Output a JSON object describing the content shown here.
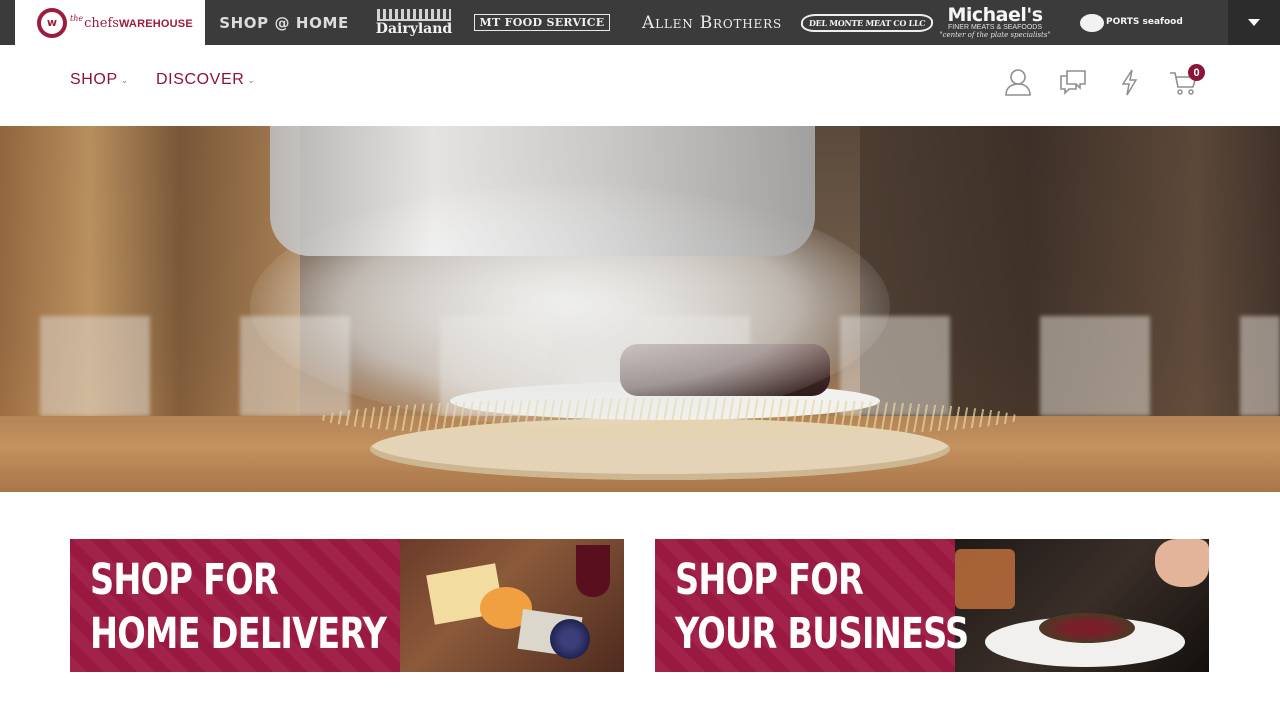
{
  "brand_bar": {
    "active_brand": {
      "name": "chefs",
      "prefix": "the",
      "suffix": "WAREHOUSE",
      "logo_letter": "w"
    },
    "brands": [
      {
        "id": "shop-at-home",
        "label": "SHOP @ HOME"
      },
      {
        "id": "dairyland",
        "label": "Dairyland"
      },
      {
        "id": "mt-food-service",
        "label": "MT FOOD SERVICE"
      },
      {
        "id": "allen-brothers",
        "label": "Allen Brothers"
      },
      {
        "id": "del-monte-meat",
        "label": "DEL MONTE MEAT CO LLC"
      },
      {
        "id": "michaels",
        "label": "Michael's",
        "sub": "FINER MEATS & SEAFOODS",
        "tagline": "\"center of the plate specialists\""
      },
      {
        "id": "ports-seafood",
        "label": "PORTS seafood"
      }
    ],
    "toggle_icon": "triangle-down-icon"
  },
  "nav": {
    "menu": [
      {
        "label": "SHOP",
        "icon": "chevron-down-icon"
      },
      {
        "label": "DISCOVER",
        "icon": "chevron-down-icon"
      }
    ],
    "icons": [
      "user-icon",
      "chat-icon",
      "lightning-icon",
      "cart-icon"
    ],
    "cart_count": "0"
  },
  "hero": {
    "image": "smoked steak under cloche on hay in restaurant"
  },
  "promos": [
    {
      "line1": "SHOP FOR",
      "line2": "HOME DELIVERY",
      "image": "cheese board"
    },
    {
      "line1": "SHOP FOR",
      "line2": "YOUR BUSINESS",
      "image": "plated meat dish"
    }
  ],
  "colors": {
    "brand": "#8a1538",
    "banner": "#9e1a42",
    "topbar": "#3b3b3b"
  }
}
